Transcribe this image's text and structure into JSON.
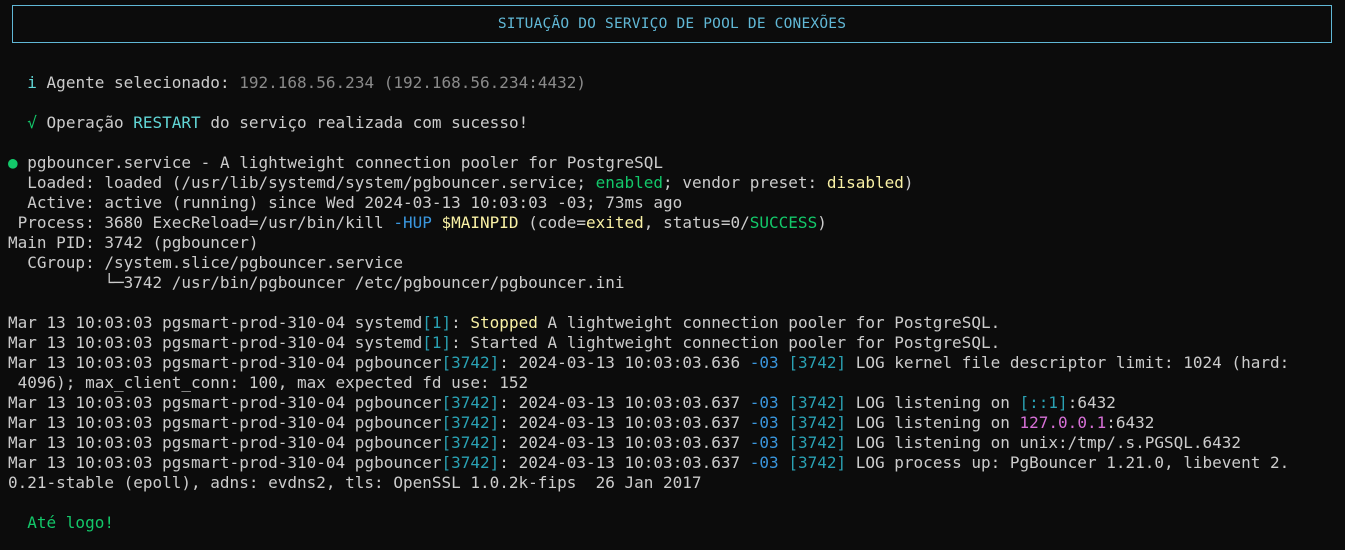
{
  "banner": {
    "title": "SITUAÇÃO DO SERVIÇO DE POOL DE CONEXÕES"
  },
  "agent": {
    "icon": "i",
    "label": "Agente selecionado:",
    "value": "192.168.56.234 (192.168.56.234:4432)"
  },
  "operation": {
    "icon": "√",
    "prefix": "Operação",
    "action": "RESTART",
    "suffix": "do serviço realizada com sucesso!"
  },
  "status": {
    "dot": "●",
    "unit_line": "pgbouncer.service - A lightweight connection pooler for PostgreSQL",
    "loaded_prefix": "  Loaded: loaded (/usr/lib/systemd/system/pgbouncer.service;",
    "loaded_enabled": "enabled",
    "loaded_mid": "; vendor preset:",
    "loaded_disabled": "disabled",
    "loaded_end": ")",
    "active_line": "  Active: active (running) since Wed 2024-03-13 10:03:03 -03; 73ms ago",
    "process_prefix": " Process: 3680 ExecReload=/usr/bin/kill",
    "process_hup": "-HUP",
    "process_mainpid": "$MAINPID",
    "process_code_pre": "(code=",
    "process_exited": "exited",
    "process_status_pre": ", status=0/",
    "process_success": "SUCCESS",
    "process_end": ")",
    "mainpid_line": "Main PID: 3742 (pgbouncer)",
    "cgroup_line": "  CGroup: /system.slice/pgbouncer.service",
    "cgroup_child": "          └─3742 /usr/bin/pgbouncer /etc/pgbouncer/pgbouncer.ini"
  },
  "logs": {
    "prefix": "Mar 13 10:03:03 pgsmart-prod-310-04",
    "l1_proc": "systemd",
    "l1_pid": "[1]",
    "l1_stopped": "Stopped",
    "l1_rest": "A lightweight connection pooler for PostgreSQL.",
    "l2_proc": "systemd",
    "l2_pid": "[1]",
    "l2_rest": ": Started A lightweight connection pooler for PostgreSQL.",
    "pb_proc": "pgbouncer",
    "pb_pid": "[3742]",
    "l3_ts": ": 2024-03-13 10:03:03.636",
    "tz": "-03",
    "l3_rest": "LOG kernel file descriptor limit: 1024 (hard:",
    "l3_cont": " 4096); max_client_conn: 100, max expected fd use: 152",
    "ts_637": ": 2024-03-13 10:03:03.637",
    "l4_pre": "LOG listening on",
    "l4_addr": "[::1]",
    "l4_port": ":6432",
    "l5_pre": "LOG listening on",
    "l5_addr": "127.0.0.1",
    "l5_port": ":6432",
    "l6_rest": "LOG listening on unix:/tmp/.s.PGSQL.6432",
    "l7_rest": "LOG process up: PgBouncer 1.21.0, libevent 2.",
    "l7_cont": "0.21-stable (epoll), adns: evdns2, tls: OpenSSL 1.0.2k-fips  26 Jan 2017"
  },
  "farewell": {
    "text": "Até logo!"
  }
}
